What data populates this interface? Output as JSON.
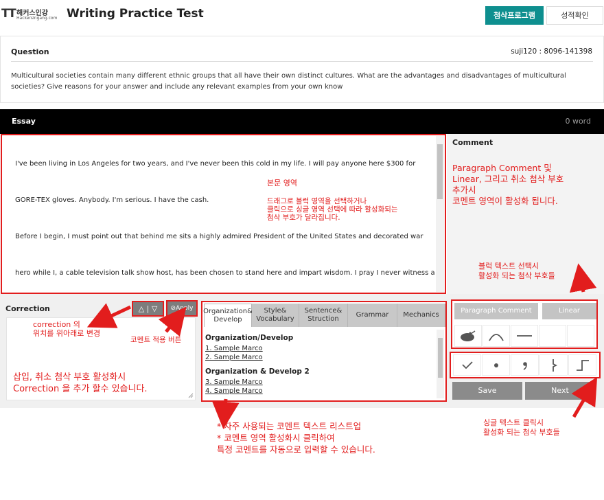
{
  "header": {
    "logo_brand": "해커스인강",
    "logo_url": "HackersIngang.com",
    "title": "Writing Practice Test",
    "program_button": "첨삭프로그램",
    "score_button": "성적확인"
  },
  "question": {
    "label": "Question",
    "user": "suji120 : 8096-141398",
    "text": "Multicultural societies contain many different ethnic groups that all have their own distinct cultures. What are the advantages and disadvantages of multicultural societies? Give reasons for your answer and include any relevant examples from your own know"
  },
  "essay": {
    "label": "Essay",
    "word_count": "0 word",
    "lines": [
      "I've been living in Los Angeles for two years, and I've never been this cold in my life. I will pay anyone here $300 for",
      "GORE-TEX gloves. Anybody. I'm serious. I have the cash.",
      "Before I begin, I must point out that behind me sits a highly admired President of the United States and decorated war",
      "hero while I, a cable television talk show host, has been chosen to stand here and impart wisdom. I pray I never witness a"
    ]
  },
  "comment": {
    "title": "Comment"
  },
  "correction": {
    "label": "Correction",
    "move_button": "△ | ▽",
    "apply_button": "Apply"
  },
  "comment_list": {
    "tabs": [
      {
        "label": "Organization&\nDevelop",
        "active": true
      },
      {
        "label": "Style&\nVocabulary",
        "active": false
      },
      {
        "label": "Sentence&\nStruction",
        "active": false
      },
      {
        "label": "Grammar",
        "active": false
      },
      {
        "label": "Mechanics",
        "active": false
      }
    ],
    "sections": [
      {
        "title": "Organization/Develop",
        "items": [
          "1. Sample Marco",
          "2. Sample Marco"
        ]
      },
      {
        "title": "Organization & Develop 2",
        "items": [
          "3. Sample Marco",
          "4. Sample Marco"
        ]
      }
    ]
  },
  "marks": {
    "paragraph_comment": "Paragraph Comment",
    "linear": "Linear",
    "top_icons": [
      "blob-mark-icon",
      "arc-mark-icon",
      "dash-mark-icon",
      "empty",
      "empty"
    ],
    "bottom_icons": [
      "check-mark-icon",
      "dot-mark-icon",
      "comma-mark-icon",
      "insert-bar-icon",
      "step-mark-icon"
    ],
    "save": "Save",
    "next": "Next"
  },
  "annotations": {
    "essay_area": "본문 영역",
    "essay_area_desc": "드래그로 블럭 영역을 선택하거나\n클릭으로 싱글 영역 선택에 따라 활성화되는\n첨삭 부호가 달라집니다.",
    "comment_area": "Paragraph Comment 및\nLinear, 그리고 취소 첨삭 부호\n추가시\n코멘트 영역이 활성화 됩니다.",
    "block_marks": "블럭 텍스트 선택시\n활성화 되는 첨삭 부호들",
    "correction_move": "correction 의\n위치를 위아래로 변경",
    "apply_desc": "코멘트 적용 버튼",
    "correction_add": "삽입, 취소 첨삭 부호 활성화시\nCorrection 을 추가 할수 있습니다.",
    "comment_list": "* 자주 사용되는 코멘트 텍스트 리스트업\n* 코멘트 영역 활성화시 클릭하여\n특정 코멘트를 자동으로 입력할 수 있습니다.",
    "single_marks": "싱글 텍스트 클릭시\n활성화 되는 첨삭 부호들"
  },
  "colors": {
    "accent": "#0e8f8f",
    "annotation": "#e21d1d",
    "essay_bar": "#000000"
  }
}
